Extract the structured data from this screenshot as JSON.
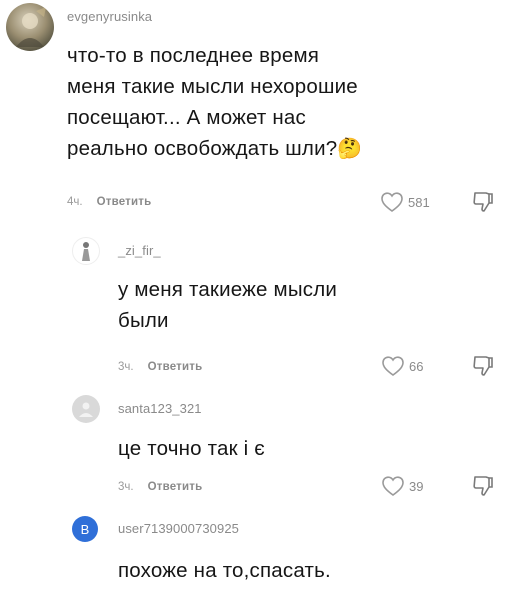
{
  "comments": [
    {
      "username": "evgenyrusinka",
      "lines": [
        "что-то в последнее время",
        "меня такие мысли нехорошие",
        "посещают... А может нас",
        "реально освобождать шли?"
      ],
      "emoji": "🤔",
      "time": "4ч.",
      "reply": "Ответить",
      "likes": "581"
    },
    {
      "username": "_zi_fir_",
      "lines": [
        "у меня такиеже мысли",
        "были"
      ],
      "time": "3ч.",
      "reply": "Ответить",
      "likes": "66"
    },
    {
      "username": "santa123_321",
      "lines": [
        "це точно так і є"
      ],
      "time": "3ч.",
      "reply": "Ответить",
      "likes": "39"
    },
    {
      "username": "user7139000730925",
      "avatar_letter": "B",
      "lines": [
        "похоже на то,спасать."
      ]
    }
  ],
  "icons": {
    "heart": "heart-outline-icon",
    "dislike": "thumbs-down-outline-icon"
  },
  "colors": {
    "avatar_blue": "#2f6fd8",
    "meta_grey": "#8a8a8a"
  }
}
